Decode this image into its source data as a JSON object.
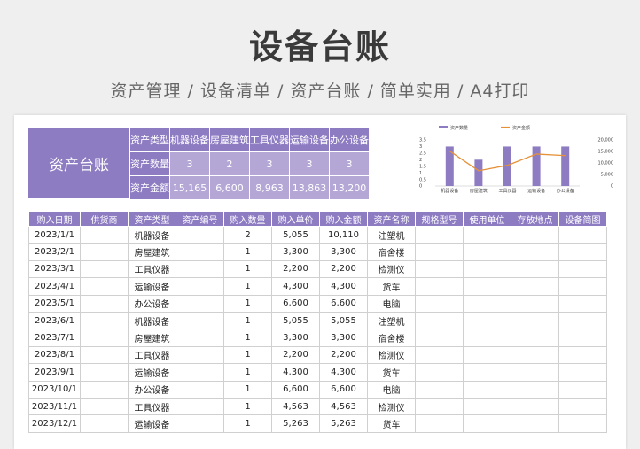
{
  "header": {
    "title": "设备台账",
    "subtitle": "资产管理 / 设备清单 / 资产台账 / 简单实用 / A4打印"
  },
  "summary": {
    "title": "资产台账",
    "rows": [
      {
        "label": "资产类型",
        "cells": [
          "机器设备",
          "房屋建筑",
          "工具仪器",
          "运输设备",
          "办公设备"
        ]
      },
      {
        "label": "资产数量",
        "cells": [
          "3",
          "2",
          "3",
          "3",
          "3"
        ]
      },
      {
        "label": "资产金额",
        "cells": [
          "15,165",
          "6,600",
          "8,963",
          "13,863",
          "13,200"
        ]
      }
    ]
  },
  "chart_data": {
    "type": "bar",
    "categories": [
      "机器设备",
      "房屋建筑",
      "工具仪器",
      "运输设备",
      "办公设备"
    ],
    "series": [
      {
        "name": "资产数量",
        "type": "bar",
        "axis": "left",
        "values": [
          3,
          2,
          3,
          3,
          3
        ],
        "color": "#8e7cc3"
      },
      {
        "name": "资产金额",
        "type": "line",
        "axis": "right",
        "values": [
          15165,
          6600,
          8963,
          13863,
          13200
        ],
        "color": "#e69138"
      }
    ],
    "y_left": {
      "ylim": [
        0,
        3.5
      ],
      "ticks": [
        "3.5",
        "3",
        "2.5",
        "2",
        "1.5",
        "1",
        "0.5",
        "0"
      ]
    },
    "y_right": {
      "ylim": [
        0,
        20000
      ],
      "ticks": [
        "20,000",
        "15,000",
        "10,000",
        "5,000",
        "0"
      ]
    },
    "legend_position": "top"
  },
  "table": {
    "headers": [
      "购入日期",
      "供货商",
      "资产类型",
      "资产编号",
      "购入数量",
      "购入单价",
      "购入金额",
      "资产名称",
      "规格型号",
      "使用单位",
      "存放地点",
      "设备简图"
    ],
    "rows": [
      [
        "2023/1/1",
        "",
        "机器设备",
        "",
        "2",
        "5,055",
        "10,110",
        "注塑机",
        "",
        "",
        "",
        ""
      ],
      [
        "2023/2/1",
        "",
        "房屋建筑",
        "",
        "1",
        "3,300",
        "3,300",
        "宿舍楼",
        "",
        "",
        "",
        ""
      ],
      [
        "2023/3/1",
        "",
        "工具仪器",
        "",
        "1",
        "2,200",
        "2,200",
        "检测仪",
        "",
        "",
        "",
        ""
      ],
      [
        "2023/4/1",
        "",
        "运输设备",
        "",
        "1",
        "4,300",
        "4,300",
        "货车",
        "",
        "",
        "",
        ""
      ],
      [
        "2023/5/1",
        "",
        "办公设备",
        "",
        "1",
        "6,600",
        "6,600",
        "电脑",
        "",
        "",
        "",
        ""
      ],
      [
        "2023/6/1",
        "",
        "机器设备",
        "",
        "1",
        "5,055",
        "5,055",
        "注塑机",
        "",
        "",
        "",
        ""
      ],
      [
        "2023/7/1",
        "",
        "房屋建筑",
        "",
        "1",
        "3,300",
        "3,300",
        "宿舍楼",
        "",
        "",
        "",
        ""
      ],
      [
        "2023/8/1",
        "",
        "工具仪器",
        "",
        "1",
        "2,200",
        "2,200",
        "检测仪",
        "",
        "",
        "",
        ""
      ],
      [
        "2023/9/1",
        "",
        "运输设备",
        "",
        "1",
        "4,300",
        "4,300",
        "货车",
        "",
        "",
        "",
        ""
      ],
      [
        "2023/10/1",
        "",
        "办公设备",
        "",
        "1",
        "6,600",
        "6,600",
        "电脑",
        "",
        "",
        "",
        ""
      ],
      [
        "2023/11/1",
        "",
        "工具仪器",
        "",
        "1",
        "4,563",
        "4,563",
        "检测仪",
        "",
        "",
        "",
        ""
      ],
      [
        "2023/12/1",
        "",
        "运输设备",
        "",
        "1",
        "5,263",
        "5,263",
        "货车",
        "",
        "",
        "",
        ""
      ]
    ]
  }
}
